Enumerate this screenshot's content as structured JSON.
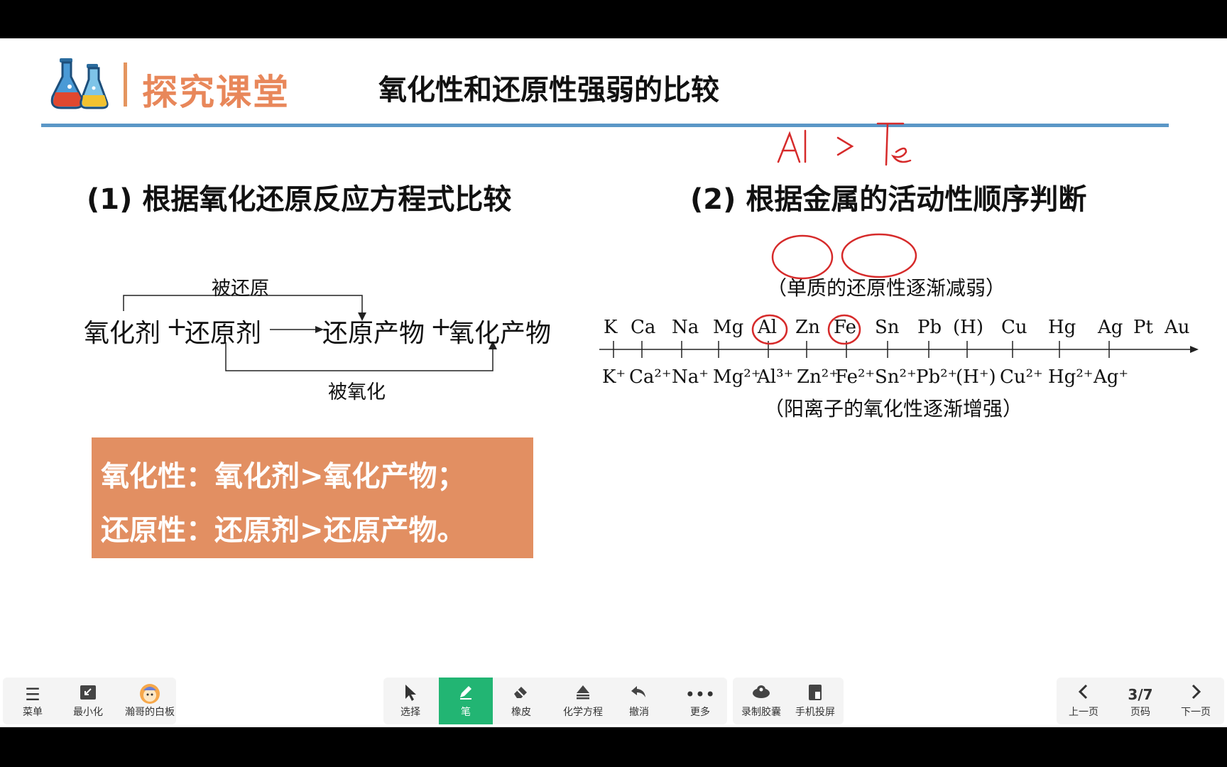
{
  "header": {
    "brand": "探究课堂",
    "title": "氧化性和还原性强弱的比较"
  },
  "sections": {
    "left_heading": "(1) 根据氧化还原反应方程式比较",
    "right_heading": "(2) 根据金属的活动性顺序判断"
  },
  "equation": {
    "top_label": "被还原",
    "bottom_label": "被氧化",
    "oxidant": "氧化剂",
    "plus1": "+",
    "reductant": "还原剂",
    "reduced_product": "还原产物",
    "plus2": "+",
    "oxidized_product": "氧化产物"
  },
  "conclusion": {
    "line1": "氧化性：氧化剂>氧化产物；",
    "line2": "还原性：还原剂>还原产物。"
  },
  "activity_series": {
    "top_caption": "（单质的还原性逐渐减弱）",
    "bottom_caption": "（阳离子的氧化性逐渐增强）",
    "elements": [
      "K",
      "Ca",
      "Na",
      "Mg",
      "Al",
      "Zn",
      "Fe",
      "Sn",
      "Pb",
      "(H)",
      "Cu",
      "Hg",
      "Ag",
      "Pt",
      "Au"
    ],
    "ions": [
      "K⁺",
      "Ca²⁺",
      "Na⁺",
      "Mg²⁺",
      "Al³⁺",
      "Zn²⁺",
      "Fe²⁺",
      "Sn²⁺",
      "Pb²⁺",
      "(H⁺)",
      "Cu²⁺",
      "Hg²⁺",
      "Ag⁺"
    ]
  },
  "handwriting": {
    "note": "Al > Fe",
    "ink_color": "#d62a2a"
  },
  "toolbar": {
    "left": [
      {
        "label": "菜单",
        "icon": "menu-icon"
      },
      {
        "label": "最小化",
        "icon": "minimize-icon"
      },
      {
        "label": "瀚哥的白板",
        "icon": "avatar-icon"
      }
    ],
    "center": [
      {
        "label": "选择",
        "icon": "cursor-icon"
      },
      {
        "label": "笔",
        "icon": "pen-icon"
      },
      {
        "label": "橡皮",
        "icon": "eraser-icon"
      },
      {
        "label": "化学方程",
        "icon": "equation-icon"
      },
      {
        "label": "撤消",
        "icon": "undo-icon"
      },
      {
        "label": "更多",
        "icon": "more-icon"
      }
    ],
    "extra": [
      {
        "label": "录制胶囊",
        "icon": "record-icon"
      },
      {
        "label": "手机投屏",
        "icon": "phone-cast-icon"
      }
    ],
    "pager": {
      "prev_label": "上一页",
      "page": "3/7",
      "page_label": "页码",
      "next_label": "下一页"
    }
  },
  "colors": {
    "brand": "#e8875a",
    "rule": "#5b97c7",
    "conclusion_bg": "#e28f62",
    "active_tool": "#22b573"
  }
}
